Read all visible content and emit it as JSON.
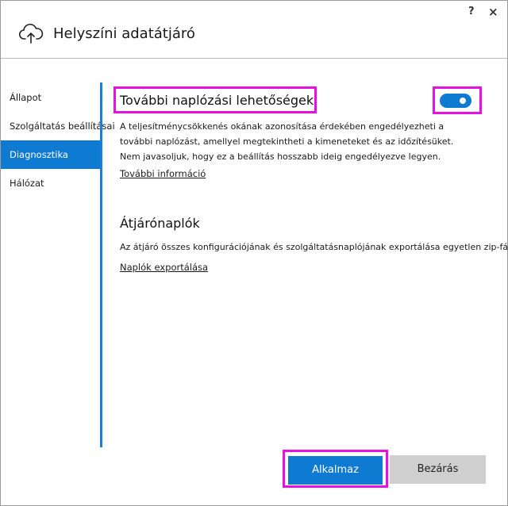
{
  "window": {
    "help_label": "?",
    "close_label": "×"
  },
  "header": {
    "title": "Helyszíni adatátjáró",
    "icon": "cloud-upload-icon"
  },
  "sidebar": {
    "items": [
      {
        "label": "Állapot"
      },
      {
        "label": "Szolgáltatás beállításai"
      },
      {
        "label": "Diagnosztika",
        "active": true
      },
      {
        "label": "Hálózat"
      }
    ]
  },
  "logging": {
    "title": "További naplózási lehetőségek",
    "description_lines": [
      "A teljesítménycsökkenés okának azonosítása érdekében engedélyezheti a",
      "további naplózást, amellyel megtekintheti a kimeneteket és az időzítésüket.",
      "Nem javasoljuk, hogy ez a beállítás hosszabb ideig engedélyezve legyen."
    ],
    "link": "További információ",
    "toggle_on": true
  },
  "gateway_logs": {
    "title": "Átjárónaplók",
    "description": "Az átjáró összes konfigurációjának és szolgáltatásnaplójának exportálása egyetlen zip-fájlba.",
    "link": "Naplók exportálása"
  },
  "buttons": {
    "apply": "Alkalmaz",
    "close": "Bezárás"
  },
  "colors": {
    "accent": "#0f7ad2",
    "highlight": "#e80fe2",
    "secondary_button": "#cfcfcf"
  }
}
